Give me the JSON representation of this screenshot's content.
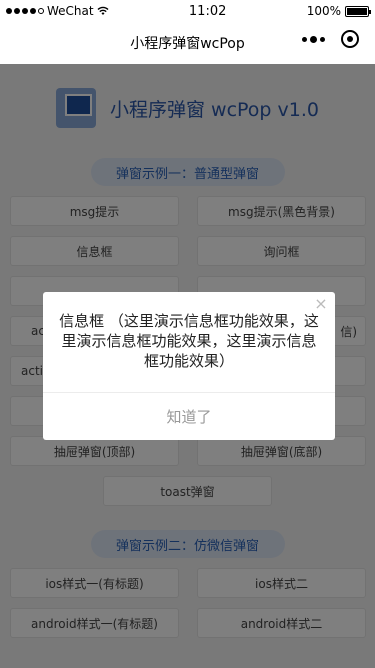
{
  "status_bar": {
    "carrier": "WeChat",
    "time": "11:02",
    "battery": "100%",
    "battery_level": 1.0
  },
  "nav": {
    "title": "小程序弹窗wcPop"
  },
  "header": {
    "title": "小程序弹窗 wcPop v1.0"
  },
  "section1": {
    "title": "弹窗示例一：普通型弹窗",
    "buttons": [
      "msg提示",
      "msg提示(黑色背景)",
      "信息框",
      "询问框",
      "",
      "",
      "ac",
      "信)",
      "acti",
      "",
      "",
      "",
      "抽屉弹窗(顶部)",
      "抽屉弹窗(底部)"
    ],
    "center_button": "toast弹窗"
  },
  "section2": {
    "title": "弹窗示例二：仿微信弹窗",
    "buttons": [
      "ios样式一(有标题)",
      "ios样式二",
      "android样式一(有标题)",
      "android样式二"
    ]
  },
  "dialog": {
    "content": "信息框 （这里演示信息框功能效果，这里演示信息框功能效果，这里演示信息框功能效果）",
    "confirm": "知道了",
    "close": "×"
  },
  "colors": {
    "accent": "#2b57a8",
    "pill_bg": "#dde6f4",
    "mask": "rgba(0,0,0,0.5)"
  }
}
